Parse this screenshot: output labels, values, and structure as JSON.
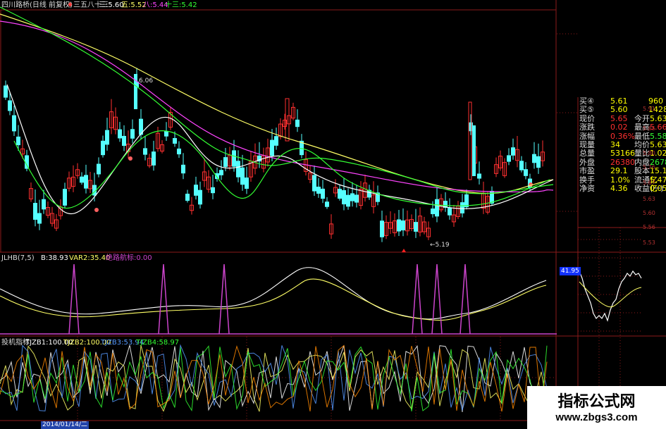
{
  "main_header": {
    "title": "四川路桥(日线 前复权)",
    "ma_label": "三五八十三",
    "ma3": "三:5.60",
    "ma5": "五:5.52",
    "ma8": "八:5.44",
    "ma13": "十三:5.42"
  },
  "annotations": {
    "high_price": "6.06",
    "low_price": "5.19"
  },
  "indicator1": {
    "name": "JLHB(7,5)",
    "b": "B:38.93",
    "var2": "VAR2:35.40",
    "signal": "绝路航标:0.00"
  },
  "indicator2": {
    "name": "投机指标",
    "tjzb1": "TJZB1:100.00",
    "tjzb2": "TJZB2:100.00",
    "tjzb3": "TJZB3:53.94",
    "tjzb4": "TJZB4:58.97"
  },
  "date_label": "2014/01/14/二",
  "quote_panel": {
    "rows": [
      {
        "label": "买④",
        "value": "5.61",
        "extra": "960",
        "vcolor": "#ffff00",
        "ecolor": "#ffff00"
      },
      {
        "label": "买⑤",
        "value": "5.60",
        "extra": "1428",
        "vcolor": "#ffff00",
        "ecolor": "#ffff00"
      },
      {
        "label": "现价",
        "value": "5.65",
        "label2": "今开",
        "value2": "5.63",
        "vcolor": "#ff3030",
        "v2color": "#ffff00"
      },
      {
        "label": "涨跌",
        "value": "0.02",
        "label2": "最高",
        "value2": "5.66",
        "vcolor": "#ff3030",
        "v2color": "#ff3030"
      },
      {
        "label": "涨幅",
        "value": "0.36%",
        "label2": "最低",
        "value2": "5.58",
        "vcolor": "#ff3030",
        "v2color": "#33ff33"
      },
      {
        "label": "现量",
        "value": "34",
        "label2": "均价",
        "value2": "5.63",
        "vcolor": "#ffff00",
        "v2color": "#ffff00"
      },
      {
        "label": "总量",
        "value": "53166",
        "label2": "量比",
        "value2": "1.02",
        "vcolor": "#ffff00",
        "v2color": "#ffff00"
      },
      {
        "label": "外盘",
        "value": "26380",
        "label2": "内盘",
        "value2": "26786",
        "vcolor": "#ff3030",
        "v2color": "#33ff33"
      },
      {
        "label": "市盈",
        "value": "29.1",
        "label2": "股本",
        "value2": "15.1亿",
        "vcolor": "#ffff00",
        "v2color": "#ffff00"
      },
      {
        "label": "换手",
        "value": "1.0%",
        "label2": "流通",
        "value2": "5.47亿",
        "vcolor": "#ffff00",
        "v2color": "#ffff00"
      },
      {
        "label": "净资",
        "value": "4.36",
        "label2": "收益(一)",
        "value2": "0.05",
        "vcolor": "#ffff00",
        "v2color": "#ffff00"
      }
    ]
  },
  "right_axis": [
    "5.91",
    "5.85",
    "5.80",
    "5.76",
    "5.67",
    "5.63",
    "5.60",
    "5.56",
    "5.53"
  ],
  "intraday_label": "41.95",
  "watermark": {
    "line1": "指标公式网",
    "line2": "www.zbgs3.com"
  },
  "colors": {
    "up": "#ff3030",
    "down": "#55ffff",
    "ma3": "#ffffff",
    "ma5": "#ffff66",
    "ma8": "#ff44ff",
    "ma13": "#33ff33",
    "grid": "#8b1a1a",
    "signal": "#cc44cc"
  }
}
